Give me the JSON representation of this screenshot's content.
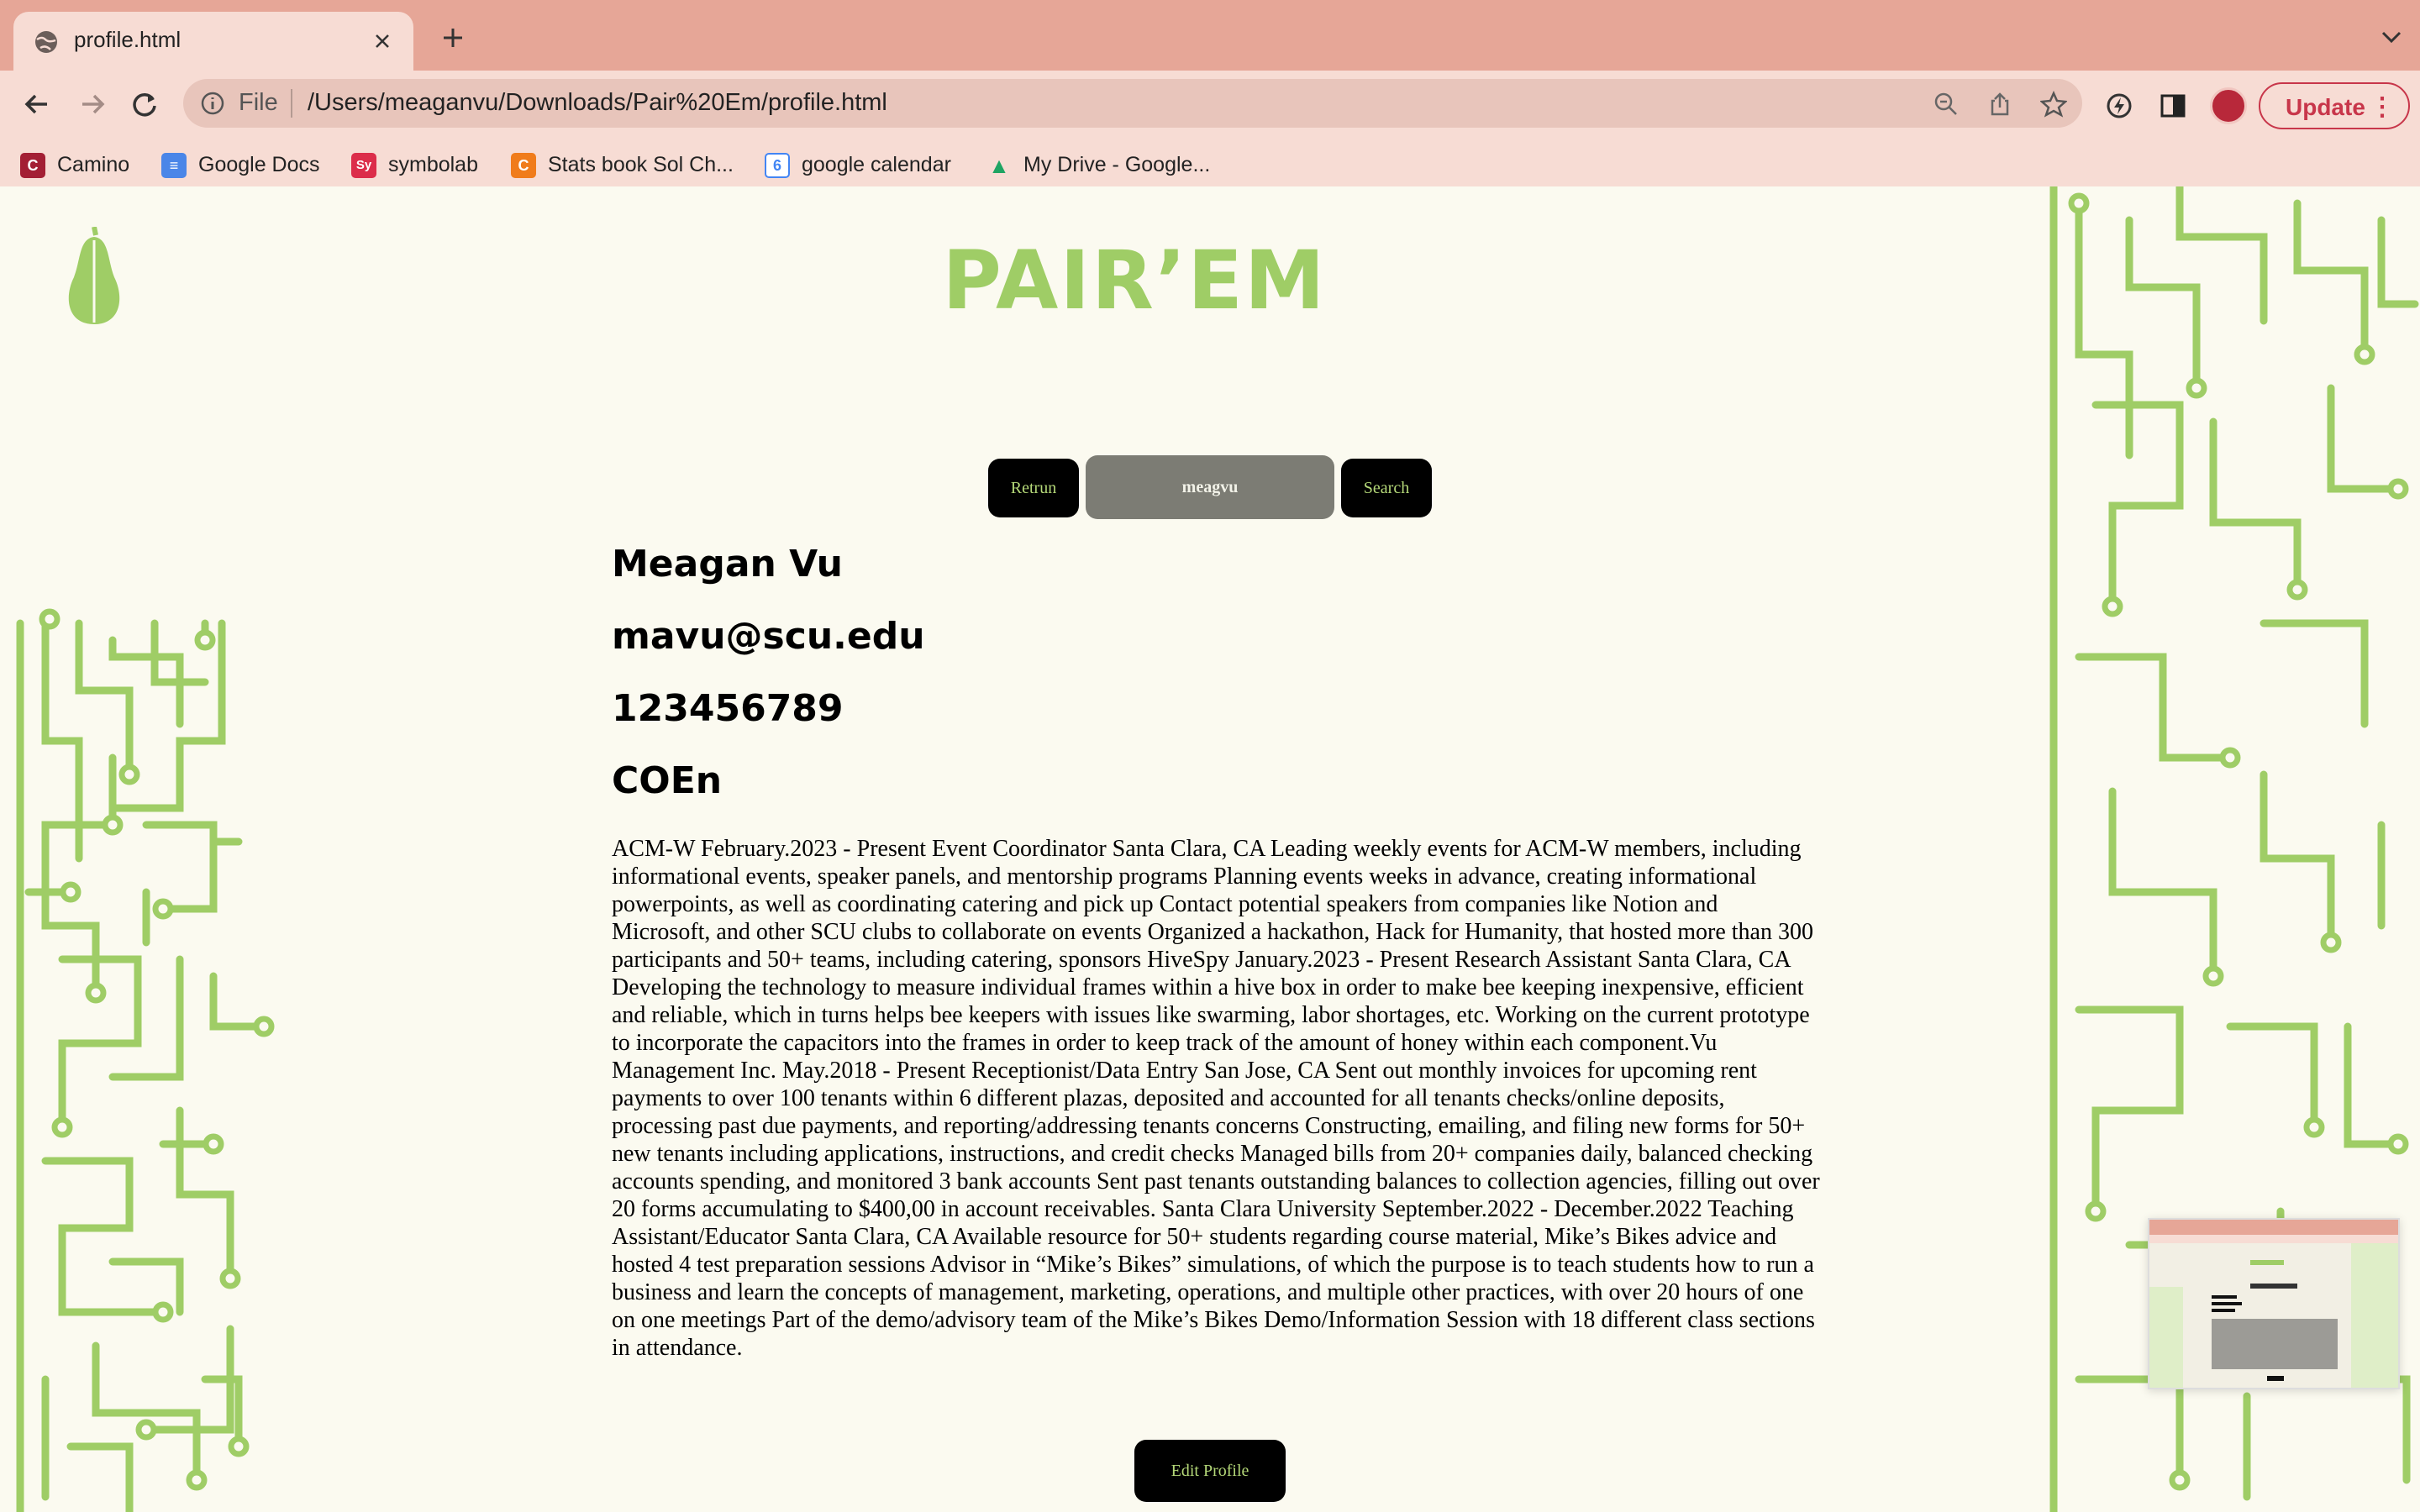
{
  "browser": {
    "tab_title": "profile.html",
    "address_scheme": "File",
    "address_url": "/Users/meaganvu/Downloads/Pair%20Em/profile.html",
    "update_label": "Update",
    "bookmarks": [
      {
        "label": "Camino",
        "icon_text": "C",
        "color": "#a31f34"
      },
      {
        "label": "Google Docs",
        "icon_text": "≡",
        "color": "#4a86e8"
      },
      {
        "label": "symbolab",
        "icon_text": "Sy",
        "color": "#dc2d4a"
      },
      {
        "label": "Stats book Sol Ch...",
        "icon_text": "C",
        "color": "#f07c1b"
      },
      {
        "label": "google calendar",
        "icon_text": "6",
        "color": "#4285f4"
      },
      {
        "label": "My Drive - Google...",
        "icon_text": "▲",
        "color": "#1fa463"
      }
    ]
  },
  "page": {
    "brand": "PAIR’EM",
    "return_label": "Retrun",
    "search_value": "meagvu",
    "search_label": "Search",
    "name": "Meagan Vu",
    "email": "mavu@scu.edu",
    "student_id": "123456789",
    "major": "COEn",
    "bio": "ACM-W February.2023 - Present Event Coordinator Santa Clara, CA Leading weekly events for ACM-W members, including informational events, speaker panels, and mentorship programs Planning events weeks in advance, creating informational powerpoints, as well as coordinating catering and pick up Contact potential speakers from companies like Notion and Microsoft, and other SCU clubs to collaborate on events Organized a hackathon, Hack for Humanity, that hosted more than 300 participants and 50+ teams, including catering, sponsors HiveSpy January.2023 - Present Research Assistant Santa Clara, CA Developing the technology to measure individual frames within a hive box in order to make bee keeping inexpensive, efficient and reliable, which in turns helps bee keepers with issues like swarming, labor shortages, etc. Working on the current prototype to incorporate the capacitors into the frames in order to keep track of the amount of honey within each component.Vu Management Inc. May.2018 - Present Receptionist/Data Entry San Jose, CA Sent out monthly invoices for upcoming rent payments to over 100 tenants within 6 different plazas, deposited and accounted for all tenants checks/online deposits, processing past due payments, and reporting/addressing tenants concerns Constructing, emailing, and filing new forms for 50+ new tenants including applications, instructions, and credit checks Managed bills from 20+ companies daily, balanced checking accounts spending, and monitored 3 bank accounts Sent past tenants outstanding balances to collection agencies, filling out over 20 forms accumulating to $400,00 in account receivables. Santa Clara University September.2022 - December.2022 Teaching Assistant/Educator Santa Clara, CA Available resource for 50+ students regarding course material, Mike’s Bikes advice and hosted 4 test preparation sessions Advisor in “Mike’s Bikes” simulations, of which the purpose is to teach students how to run a business and learn the concepts of management, marketing, operations, and multiple other practices, with over 20 hours of one on one meetings Part of the demo/advisory team of the Mike’s Bikes Demo/Information Session with 18 different class sections in attendance.",
    "edit_label": "Edit Profile"
  },
  "colors": {
    "accent_green": "#9fcd66",
    "chrome_tabstrip": "#e6a697",
    "chrome_toolbar": "#f7dcd4",
    "page_bg": "#fbfaf0"
  }
}
